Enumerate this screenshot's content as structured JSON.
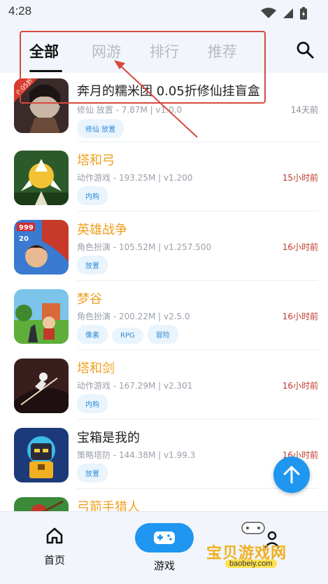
{
  "status_bar": {
    "time": "4:28"
  },
  "tabs": [
    {
      "label": "全部",
      "active": true
    },
    {
      "label": "网游",
      "active": false
    },
    {
      "label": "排行",
      "active": false
    },
    {
      "label": "推荐",
      "active": false
    }
  ],
  "games": [
    {
      "title": "奔月的糯米团 0.05折修仙挂盲盒",
      "meta": "修仙 放置 - 7.87M | v1.0.0",
      "time": "14天前",
      "tags": [
        "修仙 放置"
      ],
      "thumb_badge": "0.05折"
    },
    {
      "title": "塔和弓",
      "meta": "动作游戏 - 193.25M | v1.200",
      "time": "15小时前",
      "tags": [
        "内购"
      ]
    },
    {
      "title": "英雄战争",
      "meta": "角色扮演 - 105.52M | v1.257.500",
      "time": "16小时前",
      "tags": [
        "放置"
      ],
      "thumb_badge_1": "999",
      "thumb_badge_2": "20"
    },
    {
      "title": "梦谷",
      "meta": "角色扮演 - 200.22M | v2.5.0",
      "time": "16小时前",
      "tags": [
        "像素",
        "RPG",
        "冒险"
      ]
    },
    {
      "title": "塔和剑",
      "meta": "动作游戏 - 167.29M | v2.301",
      "time": "16小时前",
      "tags": [
        "内购"
      ]
    },
    {
      "title": "宝箱是我的",
      "meta": "策略塔防 - 144.38M | v1.99.3",
      "time": "16小时前",
      "tags": [
        "放置"
      ]
    },
    {
      "title": "弓箭手猎人",
      "meta": "",
      "time": "",
      "tags": []
    }
  ],
  "bottom_nav": {
    "home": "首页",
    "games": "游戏"
  },
  "watermark": {
    "text": "宝贝游戏网",
    "url": "baobeiy.com"
  },
  "colors": {
    "accent": "#1f96f0",
    "title_orange": "#f0a020",
    "time_red": "#c0392b",
    "annotation_red": "#d54a3f"
  }
}
